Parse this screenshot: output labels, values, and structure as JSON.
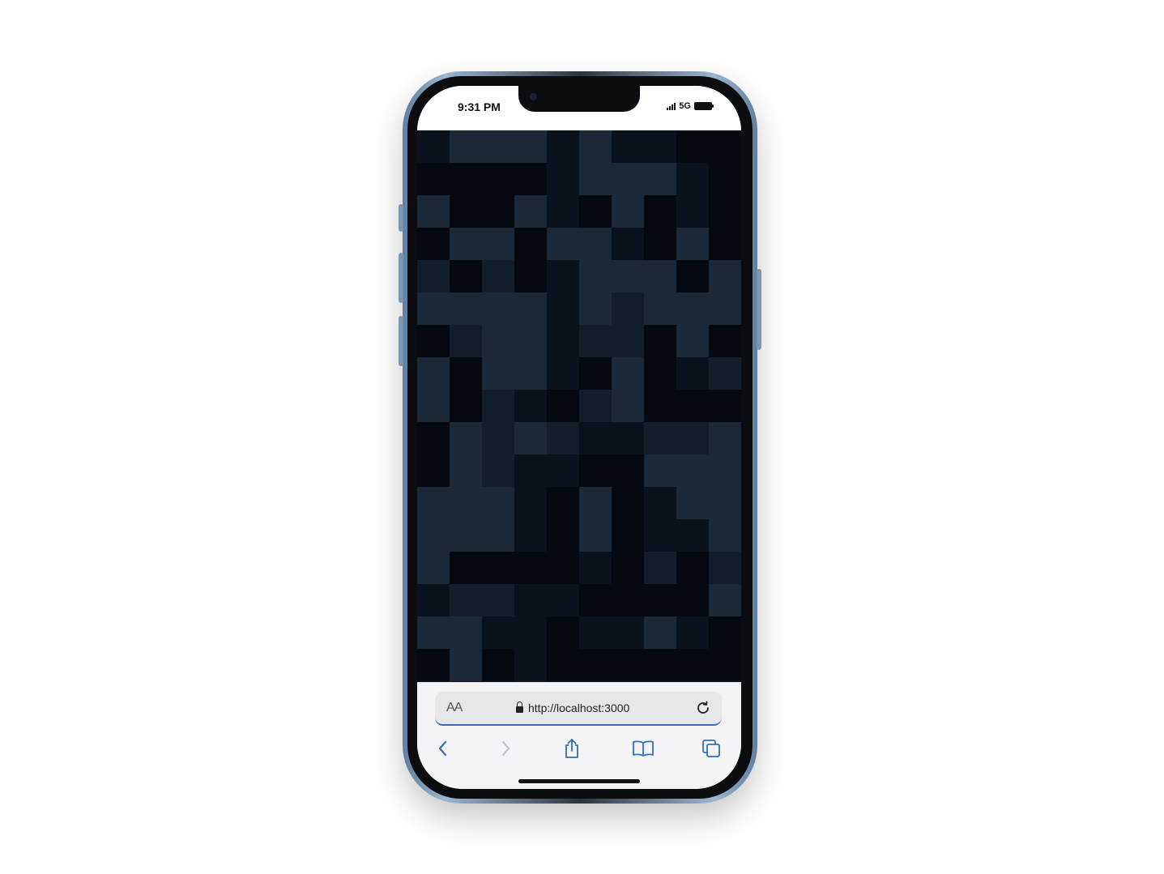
{
  "status_bar": {
    "time": "9:31 PM",
    "network": "5G"
  },
  "mosaic": {
    "columns": 10,
    "rows": 17,
    "palette": [
      "#0b111d",
      "#1b2838",
      "#06090f",
      "#141e2b"
    ],
    "cells": [
      "0111010022",
      "2222011102",
      "1221021202",
      "2112110212",
      "3232011121",
      "1111013111",
      "2311033212",
      "1211021203",
      "1230231222",
      "2131300331",
      "2130022111",
      "1110212011",
      "1110212001",
      "1222202323",
      "0330022221",
      "1100200102",
      "2120222222"
    ]
  },
  "browser": {
    "text_size_label": "AA",
    "url": "http://localhost:3000",
    "accent_color": "#2f6fbe"
  },
  "toolbar": {
    "icons": [
      "back-icon",
      "forward-icon",
      "share-icon",
      "bookmarks-icon",
      "tabs-icon"
    ]
  }
}
